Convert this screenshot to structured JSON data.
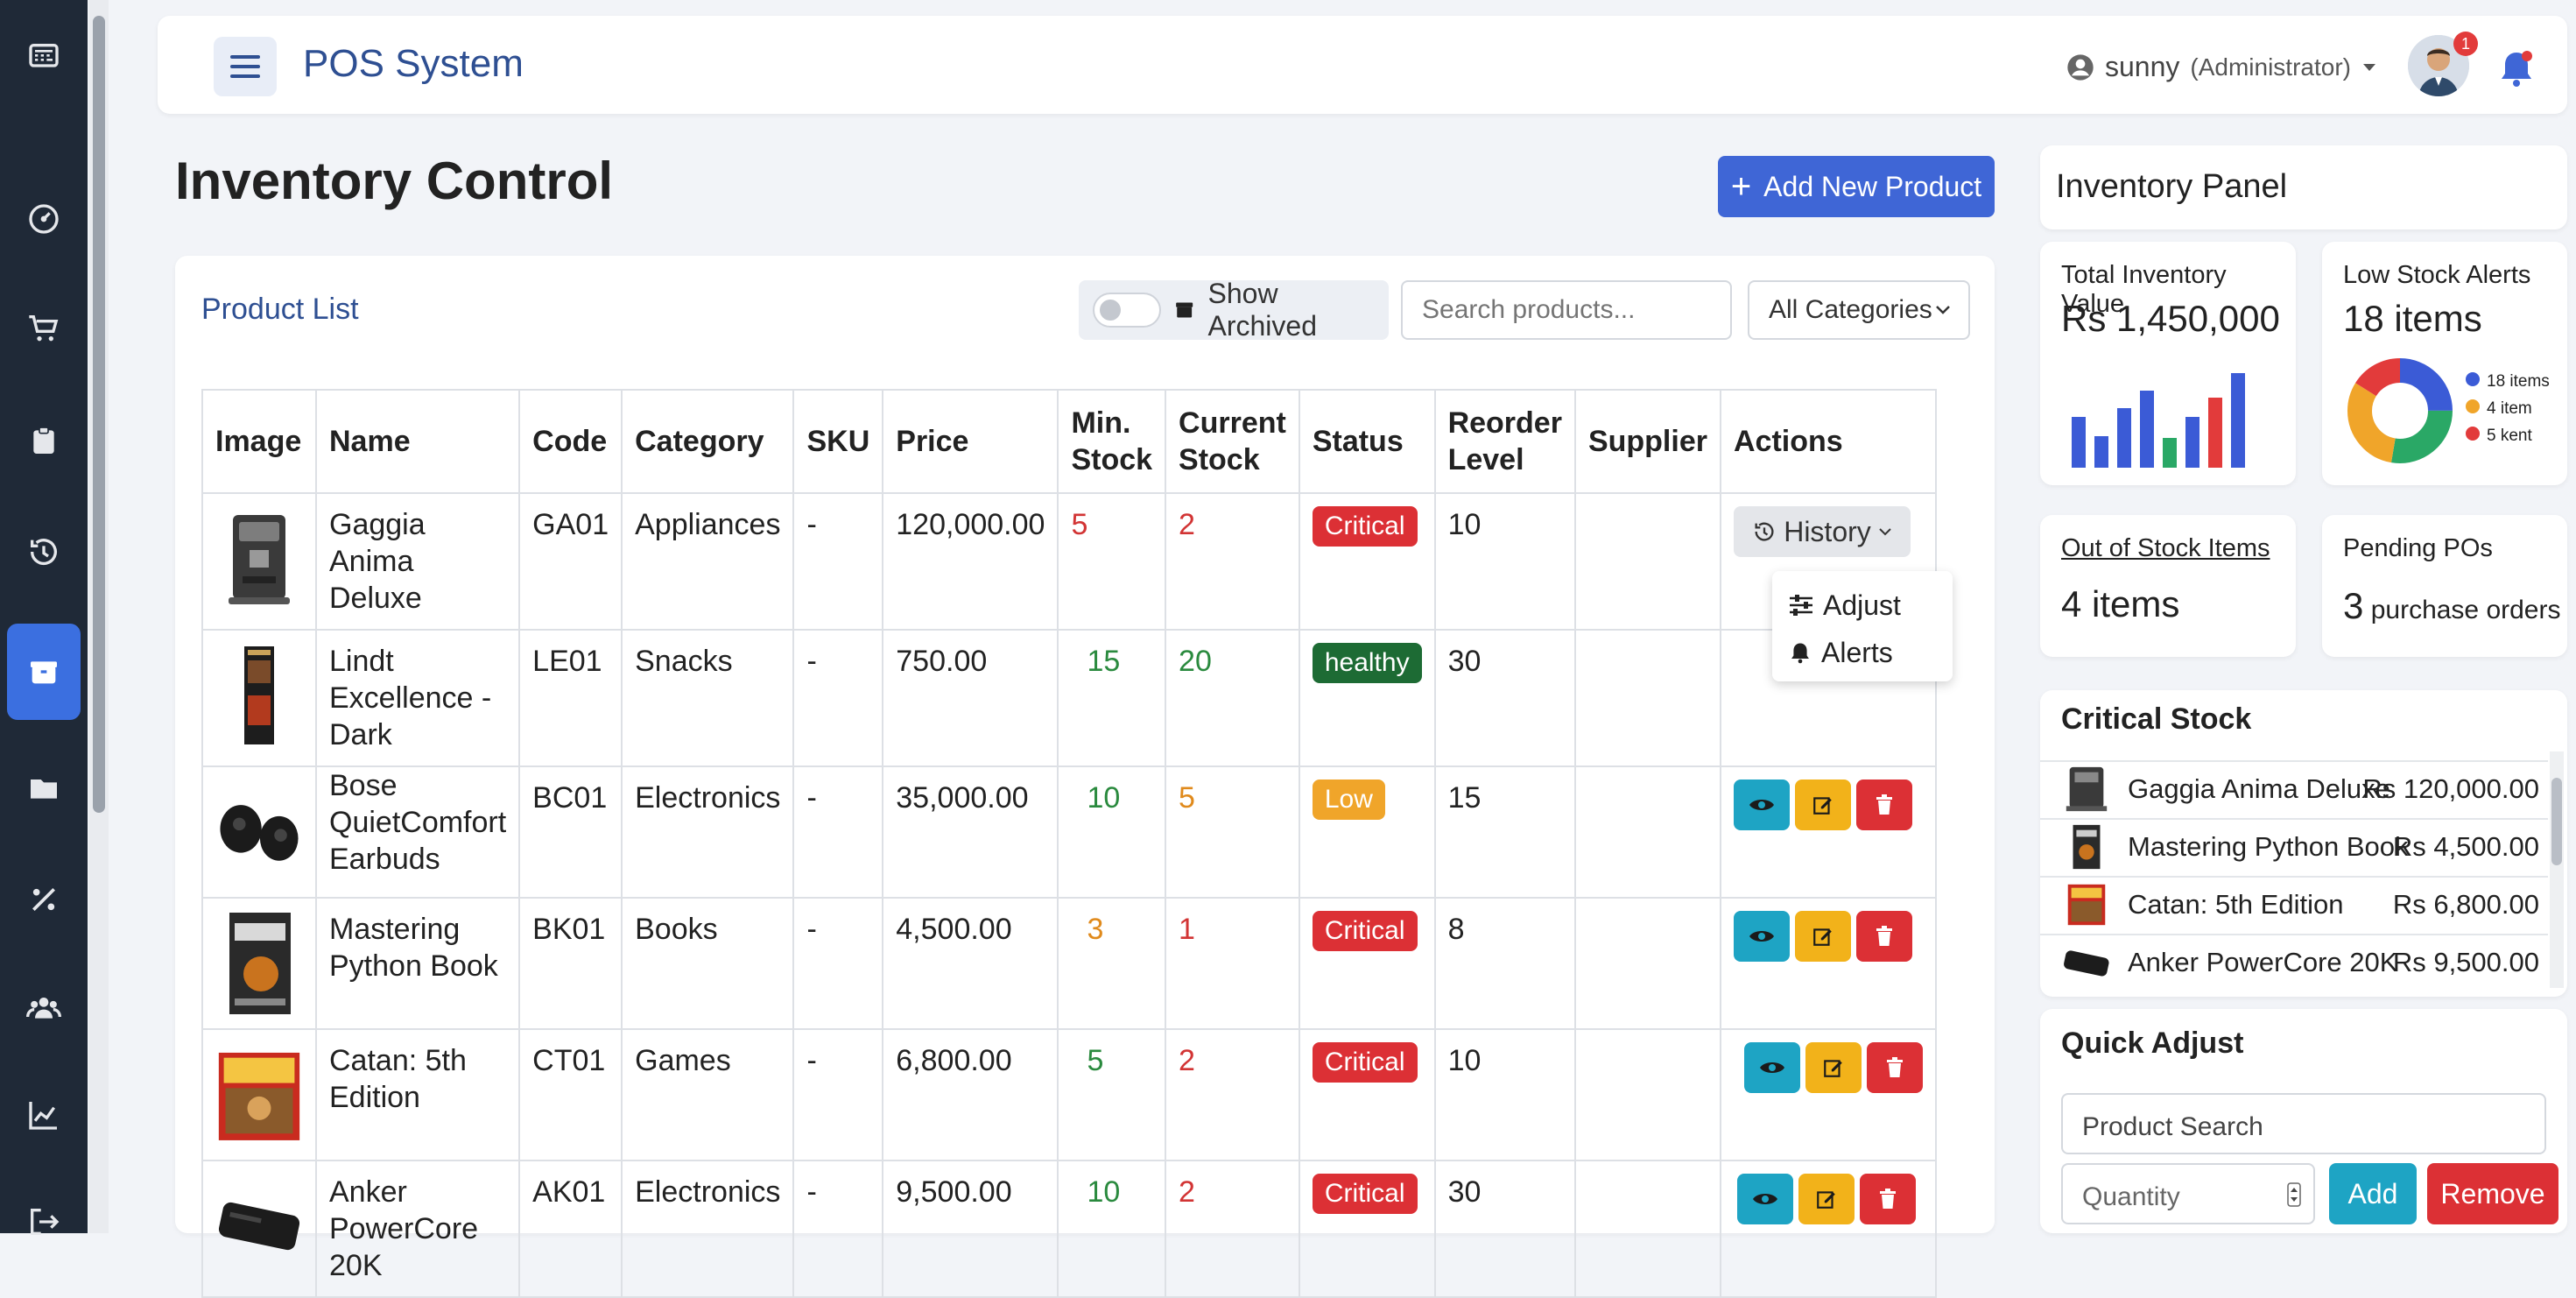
{
  "app": {
    "title": "POS System"
  },
  "user": {
    "name": "sunny",
    "role": "(Administrator)",
    "avatar_badge": "1"
  },
  "page": {
    "title": "Inventory Control",
    "add_button": "Add New Product"
  },
  "product_list": {
    "label": "Product List",
    "show_archived": "Show Archived",
    "search_placeholder": "Search products...",
    "category_filter": "All Categories",
    "columns": [
      "Image",
      "Name",
      "Code",
      "Category",
      "SKU",
      "Price",
      "Min. Stock",
      "Current Stock",
      "Status",
      "Reorder Level",
      "Supplier",
      "Actions"
    ],
    "rows": [
      {
        "name": "Gaggia Anima Deluxe",
        "code": "GA01",
        "category": "Appliances",
        "sku": "-",
        "price": "120,000.00",
        "min": "5",
        "current": "2",
        "status": "Critical",
        "reorder": "10",
        "supplier": ""
      },
      {
        "name": "Lindt Excellence - Dark",
        "code": "LE01",
        "category": "Snacks",
        "sku": "-",
        "price": "750.00",
        "min": "15",
        "current": "20",
        "status": "healthy",
        "reorder": "30",
        "supplier": ""
      },
      {
        "name": "Bose QuietComfort Earbuds",
        "code": "BC01",
        "category": "Electronics",
        "sku": "-",
        "price": "35,000.00",
        "min": "10",
        "current": "5",
        "status": "Low",
        "reorder": "15",
        "supplier": ""
      },
      {
        "name": "Mastering Python Book",
        "code": "BK01",
        "category": "Books",
        "sku": "-",
        "price": "4,500.00",
        "min": "3",
        "current": "1",
        "status": "Critical",
        "reorder": "8",
        "supplier": ""
      },
      {
        "name": "Catan: 5th Edition",
        "code": "CT01",
        "category": "Games",
        "sku": "-",
        "price": "6,800.00",
        "min": "5",
        "current": "2",
        "status": "Critical",
        "reorder": "10",
        "supplier": ""
      },
      {
        "name": "Anker PowerCore 20K",
        "code": "AK01",
        "category": "Electronics",
        "sku": "-",
        "price": "9,500.00",
        "min": "10",
        "current": "2",
        "status": "Critical",
        "reorder": "30",
        "supplier": ""
      }
    ],
    "history_button": "History",
    "history_menu": [
      "Adjust",
      "Alerts"
    ]
  },
  "inventory_panel": {
    "title": "Inventory Panel",
    "total_value_label": "Total Inventory Value",
    "total_value": "Rs 1,450,000",
    "low_stock_label": "Low Stock Alerts",
    "low_stock_value": "18 items",
    "low_stock_legend": [
      "18 items",
      "4 item",
      "5 kent"
    ],
    "out_of_stock_label": "Out of Stock Items",
    "out_of_stock_value": "4 items",
    "pending_label": "Pending POs",
    "pending_count": "3",
    "pending_unit": "purchase orders"
  },
  "critical_stock": {
    "title": "Critical Stock",
    "items": [
      {
        "name": "Gaggia Anima Deluxe",
        "price": "Rs 120,000.00"
      },
      {
        "name": "Mastering Python Book",
        "price": "Rs 4,500.00"
      },
      {
        "name": "Catan: 5th Edition",
        "price": "Rs 6,800.00"
      },
      {
        "name": "Anker PowerCore 20K",
        "price": "Rs 9,500.00"
      }
    ]
  },
  "quick_adjust": {
    "title": "Quick Adjust",
    "product_placeholder": "Product Search",
    "quantity_placeholder": "Quantity",
    "add": "Add",
    "remove": "Remove"
  },
  "colors": {
    "primary": "#3f66d6",
    "critical": "#dc3035",
    "healthy": "#1d6b34",
    "low": "#f0a52a",
    "info": "#1ea4c4",
    "sidebar": "#1f2937"
  }
}
